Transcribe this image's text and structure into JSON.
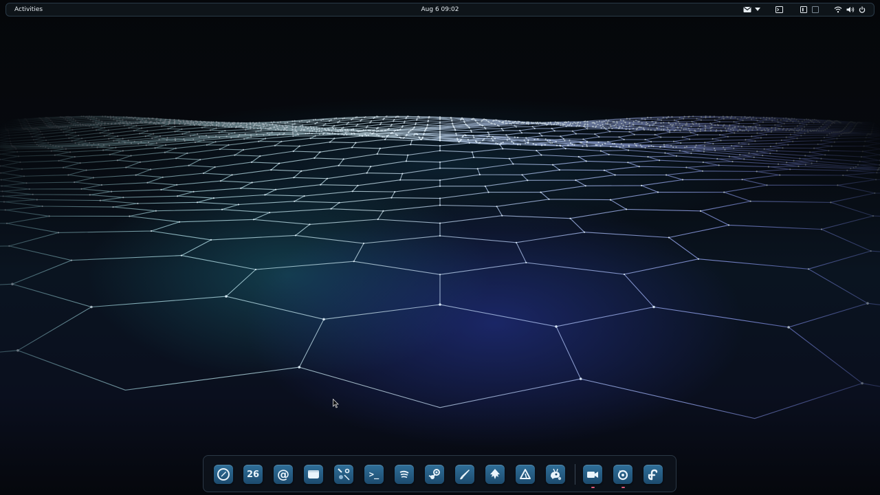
{
  "topbar": {
    "activities_label": "Activities",
    "clock": "Aug 6  09:02",
    "tray_icons": [
      "mail-icon",
      "chevron-down-icon",
      "terminal-indicator-icon",
      "workspace-1-icon",
      "workspace-2-icon",
      "wifi-icon",
      "volume-icon",
      "power-icon"
    ]
  },
  "dock": {
    "apps": [
      {
        "icon": "web-browser-icon",
        "running": false
      },
      {
        "icon": "calendar-icon",
        "label": "26",
        "running": false
      },
      {
        "icon": "mail-client-icon",
        "label": "@",
        "running": false
      },
      {
        "icon": "files-icon",
        "running": false
      },
      {
        "icon": "tweaks-icon",
        "running": false
      },
      {
        "icon": "terminal-icon",
        "label": ">_",
        "running": false
      },
      {
        "icon": "music-player-icon",
        "running": false
      },
      {
        "icon": "steam-icon",
        "running": false
      },
      {
        "icon": "drawing-icon",
        "running": false
      },
      {
        "icon": "inkscape-icon",
        "running": false
      },
      {
        "icon": "vector-app-icon",
        "running": false
      },
      {
        "icon": "gimp-icon",
        "running": false
      },
      {
        "icon": "screen-recorder-icon",
        "running": true
      },
      {
        "icon": "backup-app-icon",
        "running": true
      },
      {
        "icon": "fedora-icon",
        "running": false
      }
    ]
  },
  "colors": {
    "panel_bg": "#0e1419",
    "dock_icon_bg": "#2f6f99",
    "running_indicator": "#e05a7a",
    "mesh_teal": "#6fd6e0",
    "mesh_blue": "#5b6fd8"
  }
}
